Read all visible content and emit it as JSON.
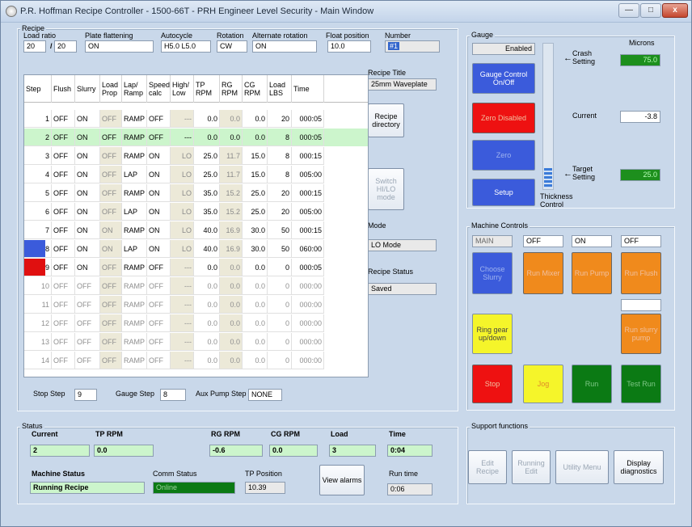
{
  "window": {
    "title": "P.R. Hoffman Recipe Controller - 1500-66T - PRH Engineer Level Security - Main Window",
    "minimize": "—",
    "maximize": "□",
    "close": "x"
  },
  "recipe": {
    "group_title": "Recipe",
    "load_ratio_label": "Load ratio",
    "load_ratio_a": "20",
    "load_ratio_sep": "/",
    "load_ratio_b": "20",
    "plate_flattening_label": "Plate flattening",
    "plate_flattening": "ON",
    "autocycle_label": "Autocycle",
    "autocycle": "H5.0 L5.0",
    "rotation_label": "Rotation",
    "rotation": "CW",
    "alternate_rotation_label": "Alternate rotation",
    "alternate_rotation": "ON",
    "float_position_label": "Float position",
    "float_position": "10.0",
    "number_label": "Number",
    "number": "#1",
    "recipe_title_label": "Recipe Title",
    "recipe_title": "25mm Waveplate",
    "recipe_directory_button": "Recipe directory",
    "switch_mode_button": "Switch HI/LO mode",
    "mode_label": "Mode",
    "mode": "LO Mode",
    "recipe_status_label": "Recipe Status",
    "recipe_status": "Saved",
    "stop_step_label": "Stop Step",
    "stop_step": "9",
    "gauge_step_label": "Gauge Step",
    "gauge_step": "8",
    "aux_pump_step_label": "Aux Pump Step",
    "aux_pump_step": "NONE"
  },
  "table": {
    "headers": [
      "Step",
      "Flush",
      "Slurry",
      "Load Prop",
      "Lap/ Ramp",
      "Speed calc",
      "High/ Low",
      "TP RPM",
      "RG RPM",
      "CG RPM",
      "Load LBS",
      "Time"
    ],
    "rows": [
      {
        "step": "1",
        "flush": "OFF",
        "slurry": "ON",
        "load_prop": "OFF",
        "lap_ramp": "RAMP",
        "speed_calc": "OFF",
        "high_low": "---",
        "tp": "0.0",
        "rg": "0.0",
        "cg": "0.0",
        "load": "20",
        "time": "000:05",
        "marker": "",
        "highlight": false,
        "inactive": false
      },
      {
        "step": "2",
        "flush": "OFF",
        "slurry": "ON",
        "load_prop": "OFF",
        "lap_ramp": "RAMP",
        "speed_calc": "OFF",
        "high_low": "---",
        "tp": "0.0",
        "rg": "0.0",
        "cg": "0.0",
        "load": "8",
        "time": "000:05",
        "marker": "",
        "highlight": true,
        "inactive": false
      },
      {
        "step": "3",
        "flush": "OFF",
        "slurry": "ON",
        "load_prop": "OFF",
        "lap_ramp": "RAMP",
        "speed_calc": "ON",
        "high_low": "LO",
        "tp": "25.0",
        "rg": "11.7",
        "cg": "15.0",
        "load": "8",
        "time": "000:15",
        "marker": "",
        "highlight": false,
        "inactive": false
      },
      {
        "step": "4",
        "flush": "OFF",
        "slurry": "ON",
        "load_prop": "OFF",
        "lap_ramp": "LAP",
        "speed_calc": "ON",
        "high_low": "LO",
        "tp": "25.0",
        "rg": "11.7",
        "cg": "15.0",
        "load": "8",
        "time": "005:00",
        "marker": "",
        "highlight": false,
        "inactive": false
      },
      {
        "step": "5",
        "flush": "OFF",
        "slurry": "ON",
        "load_prop": "OFF",
        "lap_ramp": "RAMP",
        "speed_calc": "ON",
        "high_low": "LO",
        "tp": "35.0",
        "rg": "15.2",
        "cg": "25.0",
        "load": "20",
        "time": "000:15",
        "marker": "",
        "highlight": false,
        "inactive": false
      },
      {
        "step": "6",
        "flush": "OFF",
        "slurry": "ON",
        "load_prop": "OFF",
        "lap_ramp": "LAP",
        "speed_calc": "ON",
        "high_low": "LO",
        "tp": "35.0",
        "rg": "15.2",
        "cg": "25.0",
        "load": "20",
        "time": "005:00",
        "marker": "",
        "highlight": false,
        "inactive": false
      },
      {
        "step": "7",
        "flush": "OFF",
        "slurry": "ON",
        "load_prop": "ON",
        "lap_ramp": "RAMP",
        "speed_calc": "ON",
        "high_low": "LO",
        "tp": "40.0",
        "rg": "16.9",
        "cg": "30.0",
        "load": "50",
        "time": "000:15",
        "marker": "",
        "highlight": false,
        "inactive": false
      },
      {
        "step": "8",
        "flush": "OFF",
        "slurry": "ON",
        "load_prop": "ON",
        "lap_ramp": "LAP",
        "speed_calc": "ON",
        "high_low": "LO",
        "tp": "40.0",
        "rg": "16.9",
        "cg": "30.0",
        "load": "50",
        "time": "060:00",
        "marker": "#3b5bdb",
        "highlight": false,
        "inactive": false
      },
      {
        "step": "9",
        "flush": "OFF",
        "slurry": "ON",
        "load_prop": "OFF",
        "lap_ramp": "RAMP",
        "speed_calc": "OFF",
        "high_low": "---",
        "tp": "0.0",
        "rg": "0.0",
        "cg": "0.0",
        "load": "0",
        "time": "000:05",
        "marker": "#e01010",
        "highlight": false,
        "inactive": false
      },
      {
        "step": "10",
        "flush": "OFF",
        "slurry": "OFF",
        "load_prop": "OFF",
        "lap_ramp": "RAMP",
        "speed_calc": "OFF",
        "high_low": "---",
        "tp": "0.0",
        "rg": "0.0",
        "cg": "0.0",
        "load": "0",
        "time": "000:00",
        "marker": "",
        "highlight": false,
        "inactive": true
      },
      {
        "step": "11",
        "flush": "OFF",
        "slurry": "OFF",
        "load_prop": "OFF",
        "lap_ramp": "RAMP",
        "speed_calc": "OFF",
        "high_low": "---",
        "tp": "0.0",
        "rg": "0.0",
        "cg": "0.0",
        "load": "0",
        "time": "000:00",
        "marker": "",
        "highlight": false,
        "inactive": true
      },
      {
        "step": "12",
        "flush": "OFF",
        "slurry": "OFF",
        "load_prop": "OFF",
        "lap_ramp": "RAMP",
        "speed_calc": "OFF",
        "high_low": "---",
        "tp": "0.0",
        "rg": "0.0",
        "cg": "0.0",
        "load": "0",
        "time": "000:00",
        "marker": "",
        "highlight": false,
        "inactive": true
      },
      {
        "step": "13",
        "flush": "OFF",
        "slurry": "OFF",
        "load_prop": "OFF",
        "lap_ramp": "RAMP",
        "speed_calc": "OFF",
        "high_low": "---",
        "tp": "0.0",
        "rg": "0.0",
        "cg": "0.0",
        "load": "0",
        "time": "000:00",
        "marker": "",
        "highlight": false,
        "inactive": true
      },
      {
        "step": "14",
        "flush": "OFF",
        "slurry": "OFF",
        "load_prop": "OFF",
        "lap_ramp": "RAMP",
        "speed_calc": "OFF",
        "high_low": "---",
        "tp": "0.0",
        "rg": "0.0",
        "cg": "0.0",
        "load": "0",
        "time": "000:00",
        "marker": "",
        "highlight": false,
        "inactive": true
      }
    ]
  },
  "gauge": {
    "group_title": "Gauge",
    "enabled": "Enabled",
    "gauge_control_button": "Gauge Control On/Off",
    "zero_disabled_button": "Zero Disabled",
    "zero_button": "Zero",
    "setup_button": "Setup",
    "microns_label": "Microns",
    "crash_setting_label": "Crash Setting",
    "crash_setting": "75.0",
    "current_label": "Current",
    "current": "-3.8",
    "target_setting_label": "Target Setting",
    "target_setting": "25.0",
    "thickness_control_label": "Thickness Control",
    "thickness_level": 0.14,
    "arrow": "←"
  },
  "machine": {
    "group_title": "Machine Controls",
    "status_fields": [
      "MAIN",
      "OFF",
      "ON",
      "OFF"
    ],
    "choose_slurry": "Choose Slurry",
    "run_mixer": "Run Mixer",
    "run_pump": "Run Pump",
    "run_flush": "Run Flush",
    "ring_gear": "Ring gear up/down",
    "run_slurry_pump": "Run slurry pump",
    "stop": "Stop",
    "jog": "Jog",
    "run": "Run",
    "test_run": "Test Run"
  },
  "status": {
    "group_title": "Status",
    "current_label": "Current",
    "current": "2",
    "tp_rpm_label": "TP RPM",
    "tp_rpm": "0.0",
    "rg_rpm_label": "RG RPM",
    "rg_rpm": "-0.6",
    "cg_rpm_label": "CG RPM",
    "cg_rpm": "0.0",
    "load_label": "Load",
    "load": "3",
    "time_label": "Time",
    "time": "0:04",
    "machine_status_label": "Machine Status",
    "machine_status": "Running Recipe",
    "comm_status_label": "Comm Status",
    "comm_status": "Online",
    "tp_position_label": "TP Position",
    "tp_position": "10.39",
    "view_alarms": "View alarms",
    "run_time_label": "Run time",
    "run_time": "0:06"
  },
  "support": {
    "group_title": "Support functions",
    "edit_recipe": "Edit Recipe",
    "running_edit": "Running Edit",
    "utility_menu": "Utility Menu",
    "display_diagnostics": "Display diagnostics"
  }
}
